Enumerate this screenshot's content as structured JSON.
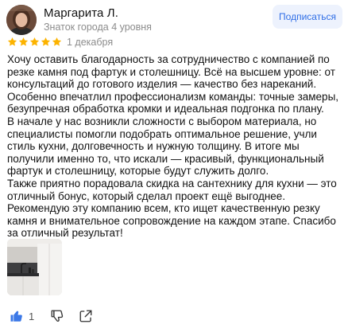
{
  "author": {
    "name": "Маргарита Л.",
    "level": "Знаток города 4 уровня"
  },
  "subscribe_label": "Подписаться",
  "rating": {
    "value": 5,
    "max": 5,
    "color": "#fcb300"
  },
  "date": "1 декабря",
  "review": {
    "paragraphs": [
      "Хочу оставить благодарность за сотрудничество с компанией по резке камня под фартук и столешницу. Всё на высшем уровне: от консультаций до готового изделия — качество без нареканий. Особенно впечатлил профессионализм команды: точные замеры, безупречная обработка кромки и идеальная подгонка по плану.",
      "В начале у нас возникли сложности с выбором материала, но специалисты помогли подобрать оптимальное решение, учли стиль кухни, долговечность и нужную толщину. В итоге мы получили именно то, что искали — красивый, функциональный фартук и столешницу, которые будут служить долго.",
      "Также приятно порадовала скидка на сантехнику для кухни — это отличный бонус, который сделал проект ещё выгоднее.",
      "Рекомендую эту компанию всем, кто ищет качественную резку камня и внимательное сопровождение на каждом этапе. Спасибо за отличный результат!"
    ]
  },
  "photos_count": 1,
  "actions": {
    "like_icon": "thumbs-up-icon",
    "like_count": "1",
    "dislike_icon": "thumbs-down-icon",
    "share_icon": "share-icon"
  },
  "colors": {
    "accent": "#2f6ee6",
    "like_blue": "#3b78e7",
    "muted_text": "#8c8c8c",
    "subscribe_bg": "#edf2fd"
  }
}
